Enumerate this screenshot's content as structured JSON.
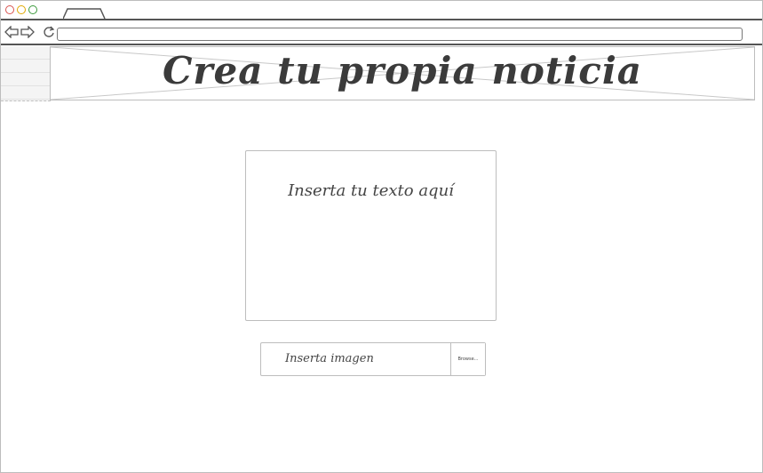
{
  "browser": {
    "window_controls": [
      "close",
      "minimize",
      "maximize"
    ],
    "nav_icons": [
      "back-arrow-icon",
      "forward-arrow-icon",
      "refresh-icon"
    ]
  },
  "banner": {
    "title": "Crea tu propia noticia"
  },
  "editor": {
    "text_placeholder": "Inserta tu texto aquí"
  },
  "image_upload": {
    "placeholder": "Inserta imagen",
    "browse_label": "Browse..."
  }
}
